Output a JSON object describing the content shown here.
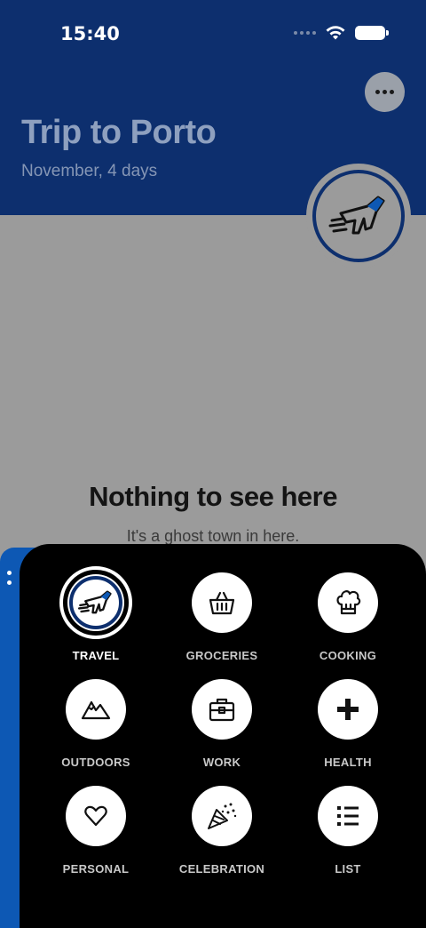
{
  "status": {
    "time": "15:40"
  },
  "header": {
    "title": "Trip to Porto",
    "subtitle": "November, 4 days",
    "more_icon": "more-horizontal-icon",
    "badge_icon": "plane-icon"
  },
  "empty": {
    "title": "Nothing to see here",
    "subtitle": "It's a ghost town in here."
  },
  "categories": [
    {
      "label": "TRAVEL",
      "icon": "plane-icon",
      "selected": true
    },
    {
      "label": "GROCERIES",
      "icon": "basket-icon",
      "selected": false
    },
    {
      "label": "COOKING",
      "icon": "chef-hat-icon",
      "selected": false
    },
    {
      "label": "OUTDOORS",
      "icon": "mountains-icon",
      "selected": false
    },
    {
      "label": "WORK",
      "icon": "briefcase-icon",
      "selected": false
    },
    {
      "label": "HEALTH",
      "icon": "plus-icon",
      "selected": false
    },
    {
      "label": "PERSONAL",
      "icon": "heart-icon",
      "selected": false
    },
    {
      "label": "CELEBRATION",
      "icon": "party-popper-icon",
      "selected": false
    },
    {
      "label": "LIST",
      "icon": "list-icon",
      "selected": false
    }
  ],
  "colors": {
    "header": "#0d2f6e",
    "accent": "#0d58b4",
    "sheet": "#000000"
  }
}
